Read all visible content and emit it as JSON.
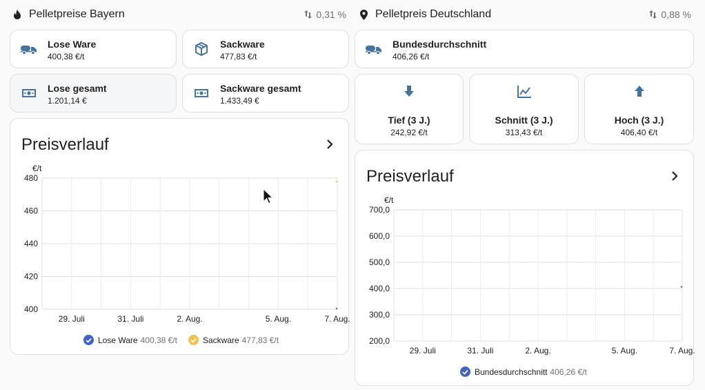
{
  "bayern": {
    "header": {
      "title": "Pelletpreise Bayern",
      "trend": "0,31 %",
      "icon": "fire-icon",
      "trend_icon": "swap-vertical-icon"
    },
    "tiles": [
      {
        "name": "Lose Ware",
        "value": "400,38 €/t",
        "icon": "tanker-truck-icon"
      },
      {
        "name": "Sackware",
        "value": "477,83 €/t",
        "icon": "package-icon"
      },
      {
        "name": "Lose gesamt",
        "value": "1.201,14 €",
        "icon": "cash-icon"
      },
      {
        "name": "Sackware gesamt",
        "value": "1.433,49 €",
        "icon": "cash-icon"
      }
    ],
    "chart": {
      "title": "Preisverlauf",
      "unit": "€/t",
      "legend": [
        {
          "name": "Lose Ware",
          "value": "400,38 €/t",
          "color": "#3f63c6"
        },
        {
          "name": "Sackware",
          "value": "477,83 €/t",
          "color": "#f2c14e"
        }
      ]
    }
  },
  "deutschland": {
    "header": {
      "title": "Pelletpreis Deutschland",
      "trend": "0,88 %",
      "icon": "map-marker-icon",
      "trend_icon": "swap-vertical-icon"
    },
    "tile": {
      "name": "Bundesdurchschnitt",
      "value": "406,26 €/t",
      "icon": "tanker-truck-icon"
    },
    "stats": [
      {
        "name": "Tief (3 J.)",
        "value": "242,92 €/t",
        "icon": "arrow-down-icon"
      },
      {
        "name": "Schnitt (3 J.)",
        "value": "313,43 €/t",
        "icon": "chart-line-icon"
      },
      {
        "name": "Hoch (3 J.)",
        "value": "406,40 €/t",
        "icon": "arrow-up-icon"
      }
    ],
    "chart": {
      "title": "Preisverlauf",
      "unit": "€/t",
      "legend": [
        {
          "name": "Bundesdurchschnitt",
          "value": "406,26 €/t",
          "color": "#3f63c6"
        }
      ]
    }
  },
  "chart_data": [
    {
      "type": "line",
      "title": "Preisverlauf",
      "ylabel": "€/t",
      "ylim": [
        400,
        480
      ],
      "y_ticks": [
        400,
        420,
        440,
        460,
        480
      ],
      "y_tick_labels": [
        "400",
        "420",
        "440",
        "460",
        "480"
      ],
      "x_range": [
        "2024-07-28",
        "2024-08-07"
      ],
      "x_ticks": [
        {
          "date": "2024-07-29",
          "label": "29. Juli"
        },
        {
          "date": "2024-07-31",
          "label": "31. Juli"
        },
        {
          "date": "2024-08-02",
          "label": "2. Aug."
        },
        {
          "date": "2024-08-05",
          "label": "5. Aug."
        },
        {
          "date": "2024-08-07",
          "label": "7. Aug."
        }
      ],
      "grid": true,
      "legend": "bottom",
      "series": [
        {
          "name": "Lose Ware",
          "color": "#3f63c6",
          "points": [
            {
              "x": "2024-08-07",
              "y": 400.38
            }
          ]
        },
        {
          "name": "Sackware",
          "color": "#f2c14e",
          "points": [
            {
              "x": "2024-08-07",
              "y": 477.83
            }
          ]
        }
      ]
    },
    {
      "type": "line",
      "title": "Preisverlauf",
      "ylabel": "€/t",
      "ylim": [
        200,
        700
      ],
      "y_ticks": [
        200,
        300,
        400,
        500,
        600,
        700
      ],
      "y_tick_labels": [
        "200,0",
        "300,0",
        "400,0",
        "500,0",
        "600,0",
        "700,0"
      ],
      "x_range": [
        "2024-07-28",
        "2024-08-07"
      ],
      "x_ticks": [
        {
          "date": "2024-07-29",
          "label": "29. Juli"
        },
        {
          "date": "2024-07-31",
          "label": "31. Juli"
        },
        {
          "date": "2024-08-02",
          "label": "2. Aug."
        },
        {
          "date": "2024-08-05",
          "label": "5. Aug."
        },
        {
          "date": "2024-08-07",
          "label": "7. Aug."
        }
      ],
      "grid": true,
      "legend": "bottom",
      "series": [
        {
          "name": "Bundesdurchschnitt",
          "color": "#3f63c6",
          "points": [
            {
              "x": "2024-08-07",
              "y": 406.26
            }
          ]
        }
      ]
    }
  ]
}
